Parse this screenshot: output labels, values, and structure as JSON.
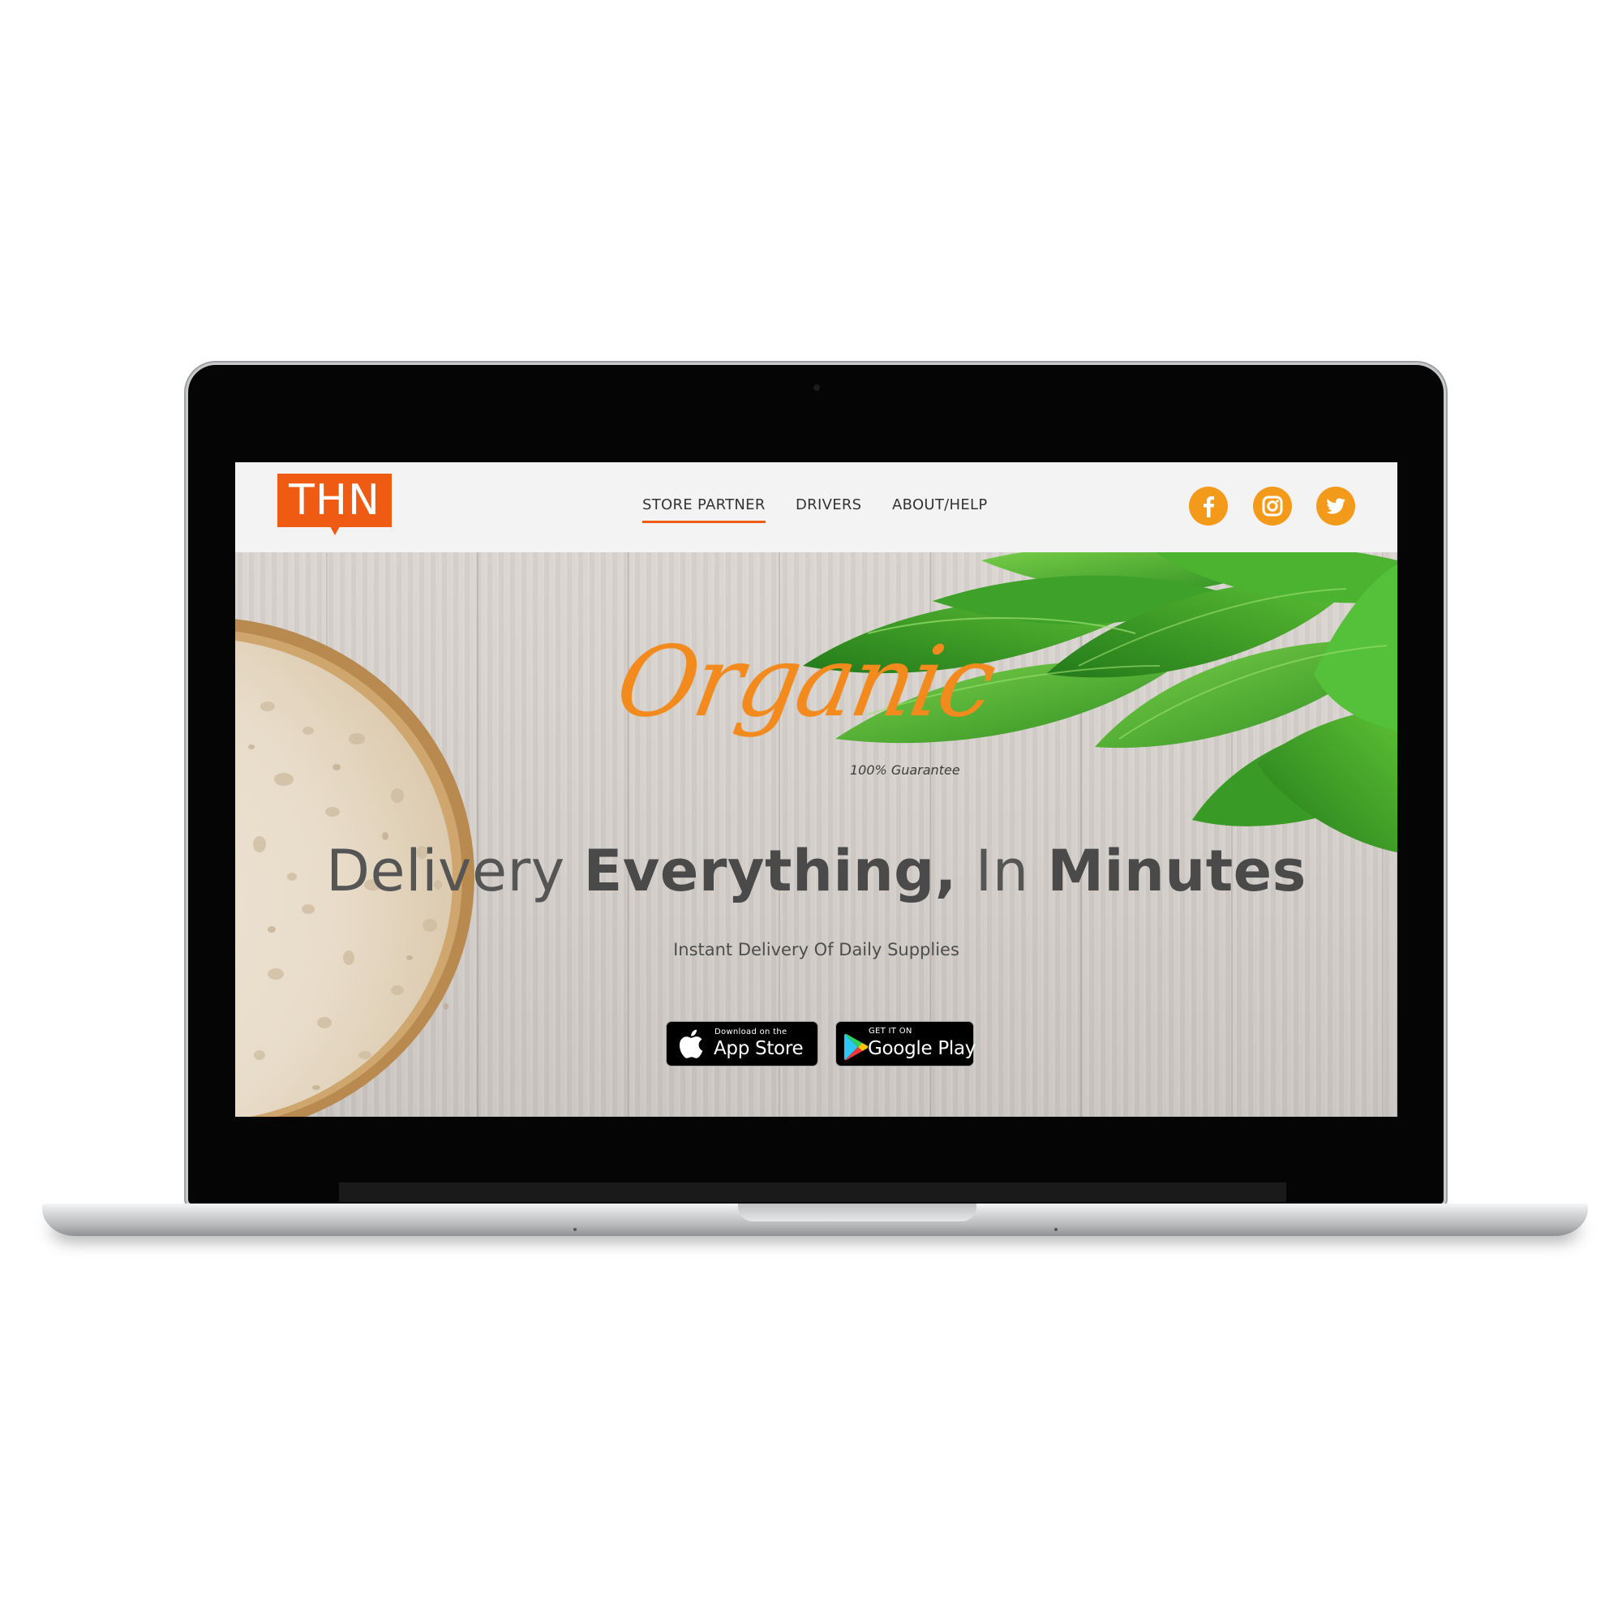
{
  "brand": {
    "logo_text": "THN",
    "accent_color": "#ef5b12",
    "social_color": "#f49a1a"
  },
  "nav": {
    "links": [
      {
        "label": "STORE PARTNER",
        "active": true
      },
      {
        "label": "DRIVERS",
        "active": false
      },
      {
        "label": "ABOUT/HELP",
        "active": false
      }
    ],
    "social": [
      {
        "icon": "facebook-icon"
      },
      {
        "icon": "instagram-icon"
      },
      {
        "icon": "twitter-icon"
      }
    ]
  },
  "hero": {
    "organic_script": "Organic",
    "guarantee": "100% Guarantee",
    "headline": {
      "part1": "Delivery ",
      "part2": "Everything,",
      "part3": " In ",
      "part4": "Minutes"
    },
    "subheadline": "Instant Delivery Of Daily Supplies",
    "app_store": {
      "small": "Download on the",
      "big": "App Store",
      "icon": "apple-icon"
    },
    "google_play": {
      "small": "GET IT ON",
      "big": "Google Play",
      "icon": "google-play-icon"
    }
  }
}
